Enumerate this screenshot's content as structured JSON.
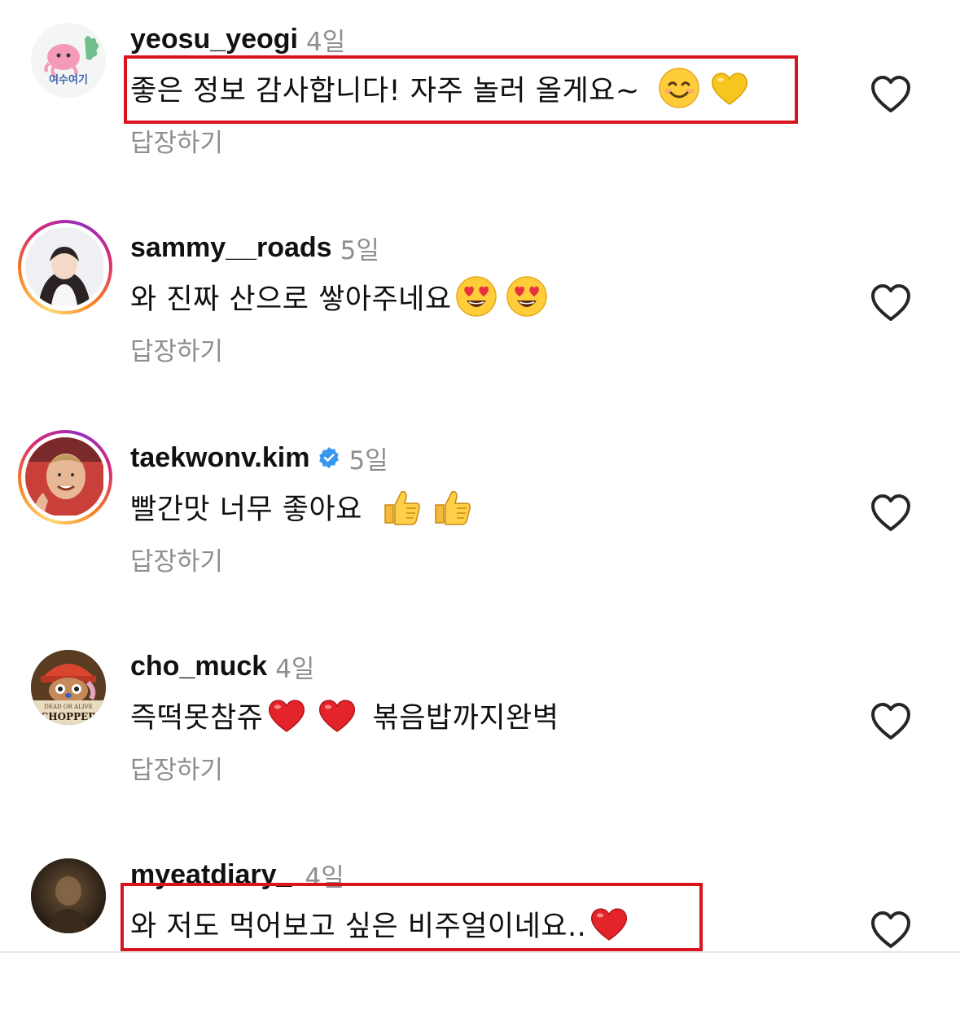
{
  "comments": [
    {
      "username": "yeosu_yeogi",
      "time": "4일",
      "text": "좋은 정보 감사합니다! 자주 놀러 올게요~",
      "emojis": [
        "smiling-face-emoji",
        "yellow-heart-emoji"
      ],
      "reply": "답장하기",
      "avatar_text": "여수여기",
      "verified": false,
      "story_ring": false
    },
    {
      "username": "sammy__roads",
      "time": "5일",
      "text": "와 진짜 산으로 쌓아주네요",
      "emojis": [
        "heart-eyes-emoji",
        "heart-eyes-emoji"
      ],
      "reply": "답장하기",
      "verified": false,
      "story_ring": true
    },
    {
      "username": "taekwonv.kim",
      "time": "5일",
      "text": "빨간맛 너무 좋아요",
      "emojis": [
        "thumbs-up-emoji",
        "thumbs-up-emoji"
      ],
      "reply": "답장하기",
      "verified": true,
      "story_ring": true
    },
    {
      "username": "cho_muck",
      "time": "4일",
      "text_before": "즉떡못참쥬",
      "text_after": "볶음밥까지완벽",
      "emojis": [
        "red-heart-emoji",
        "red-heart-emoji"
      ],
      "reply": "답장하기",
      "avatar_text_1": "DEAD OR ALIVE",
      "avatar_text_2": "CHOPPER",
      "verified": false,
      "story_ring": false
    },
    {
      "username": "myeatdiary_",
      "time": "4일",
      "text": "와 저도 먹어보고 싶은 비주얼이네요..",
      "emojis": [
        "red-heart-emoji"
      ],
      "verified": false,
      "story_ring": false
    }
  ],
  "colors": {
    "highlight": "#d8151d",
    "muted_text": "#8e8e8e",
    "verified_blue": "#3897f0"
  },
  "icons": {
    "like": "heart-outline-icon",
    "verified": "verified-badge-icon"
  }
}
